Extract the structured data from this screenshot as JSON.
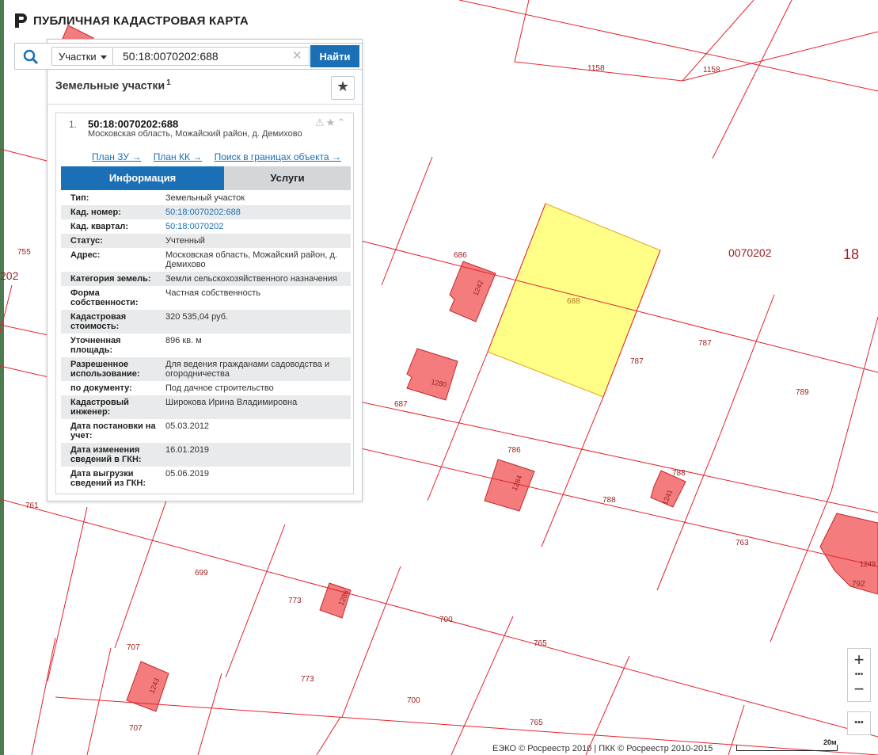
{
  "app": {
    "title": "ПУБЛИЧНАЯ КАДАСТРОВАЯ КАРТА"
  },
  "search": {
    "type_label": "Участки",
    "query": "50:18:0070202:688",
    "find_label": "Найти"
  },
  "results": {
    "title": "Земельные участки",
    "count": "1",
    "item": {
      "index": "1.",
      "cad_number": "50:18:0070202:688",
      "address_short": "Московская область, Можайский район, д. Демихово",
      "links": [
        "План ЗУ →",
        "План КК →",
        "Поиск в границах объекта →"
      ],
      "tabs": {
        "info": "Информация",
        "services": "Услуги"
      },
      "rows": [
        {
          "label": "Тип:",
          "value": "Земельный участок"
        },
        {
          "label": "Кад. номер:",
          "value": "50:18:0070202:688",
          "link": true
        },
        {
          "label": "Кад. квартал:",
          "value": "50:18:0070202",
          "link": true
        },
        {
          "label": "Статус:",
          "value": "Учтенный"
        },
        {
          "label": "Адрес:",
          "value": "Московская область, Можайский район, д. Демихово"
        },
        {
          "label": "Категория земель:",
          "value": "Земли сельскохозяйственного назначения"
        },
        {
          "label": "Форма собственности:",
          "value": "Частная собственность"
        },
        {
          "label": "Кадастровая стоимость:",
          "value": "320 535,04 руб."
        },
        {
          "label": "Уточненная площадь:",
          "value": "896 кв. м"
        },
        {
          "label": "Разрешенное использование:",
          "value": "Для ведения гражданами садоводства и огородничества"
        },
        {
          "label": "по документу:",
          "value": "Под дачное строительство"
        },
        {
          "label": "Кадастровый инженер:",
          "value": "Широкова Ирина Владимировна"
        },
        {
          "label": "Дата постановки на учет:",
          "value": "05.03.2012"
        },
        {
          "label": "Дата изменения сведений в ГКН:",
          "value": "16.01.2019"
        },
        {
          "label": "Дата выгрузки сведений из ГКН:",
          "value": "05.06.2019"
        }
      ]
    }
  },
  "map": {
    "quarter_label": "0070202",
    "district_label": "18",
    "left_labels": [
      "755",
      "202",
      "761"
    ],
    "parcel_labels": [
      "1158",
      "1158",
      "686",
      "688",
      "787",
      "787",
      "789",
      "687",
      "786",
      "788",
      "788",
      "763",
      "699",
      "773",
      "700",
      "765",
      "707",
      "707",
      "773",
      "700",
      "765",
      "792"
    ],
    "building_labels": [
      "1242",
      "1280",
      "1284",
      "1241",
      "1249",
      "1286",
      "1243"
    ],
    "colors": {
      "boundary": "#e8202a",
      "building_fill": "#f47c7c",
      "selected_fill": "#ffff88",
      "label": "#9c1d1d"
    }
  },
  "controls": {
    "zoom_in": "+",
    "zoom_dots": "•••",
    "zoom_out": "−",
    "more": "•••"
  },
  "footer": {
    "copyright": "ЕЭКО © Росреестр 2010 | ПКК © Росреестр 2010-2015",
    "scale": "20м"
  }
}
